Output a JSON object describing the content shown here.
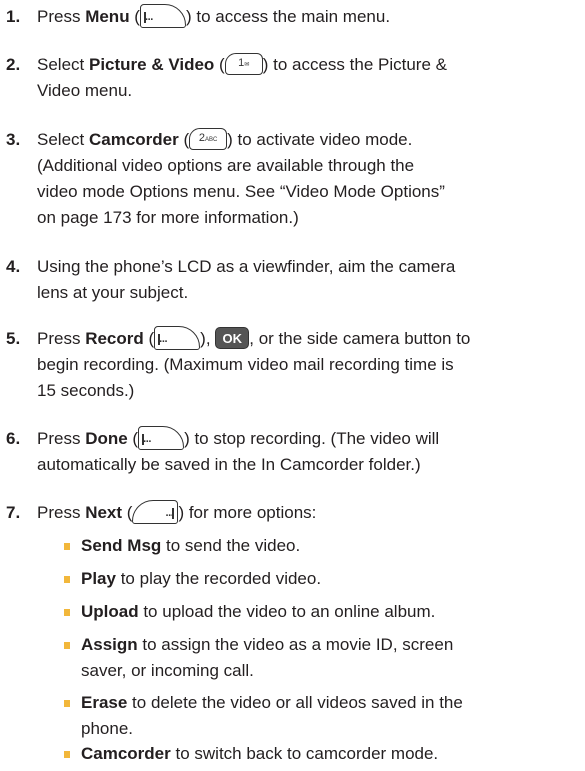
{
  "keys": {
    "ellipsis": "···",
    "num1": "1",
    "num1_sub": "✉",
    "num2": "2",
    "num2_sub": "ABC",
    "ok": "OK"
  },
  "steps": [
    {
      "num": "1.",
      "l1a": "Press ",
      "l1b": "Menu",
      "l1c": " (",
      "l1d": ") to access the main menu."
    },
    {
      "num": "2.",
      "l1a": "Select ",
      "l1b": "Picture & Video",
      "l1c": " (",
      "l1d": ") to access the Picture &",
      "l2": "Video menu."
    },
    {
      "num": "3.",
      "l1a": "Select ",
      "l1b": "Camcorder",
      "l1c": " (",
      "l1d": ") to activate video mode.",
      "l2": "(Additional video options are available through the",
      "l3": "video mode Options menu. See “Video Mode Options”",
      "l4": "on page 173 for more information.)"
    },
    {
      "num": "4.",
      "l1": "Using the phone’s LCD as a viewfinder, aim the camera",
      "l2": "lens at your subject."
    },
    {
      "num": "5.",
      "l1a": "Press ",
      "l1b": "Record",
      "l1c": " (",
      "l1d": "), ",
      "l1e": ", or the side camera button to",
      "l2": "begin recording. (Maximum video mail recording time is",
      "l3": "15 seconds.)"
    },
    {
      "num": "6.",
      "l1a": "Press ",
      "l1b": "Done",
      "l1c": " (",
      "l1d": ") to stop recording. (The video will",
      "l2": "automatically be saved in the In Camcorder folder.)"
    },
    {
      "num": "7.",
      "l1a": "Press ",
      "l1b": "Next",
      "l1c": " (",
      "l1d": ") for more options:"
    }
  ],
  "options": [
    {
      "term": "Send Msg",
      "desc": " to send the video."
    },
    {
      "term": "Play",
      "desc": " to play the recorded video."
    },
    {
      "term": "Upload",
      "desc": " to upload the video to an online album."
    },
    {
      "term": "Assign",
      "desc": " to assign the video as a movie ID, screen",
      "desc2": "saver, or incoming call."
    },
    {
      "term": "Erase",
      "desc": " to delete the video or all videos saved in the",
      "desc2": "phone."
    },
    {
      "term": "Camcorder",
      "desc": " to switch back to camcorder mode."
    }
  ],
  "colors": {
    "text": "#231f20",
    "bullet": "#f2b73b",
    "ok_key": "#555555"
  }
}
